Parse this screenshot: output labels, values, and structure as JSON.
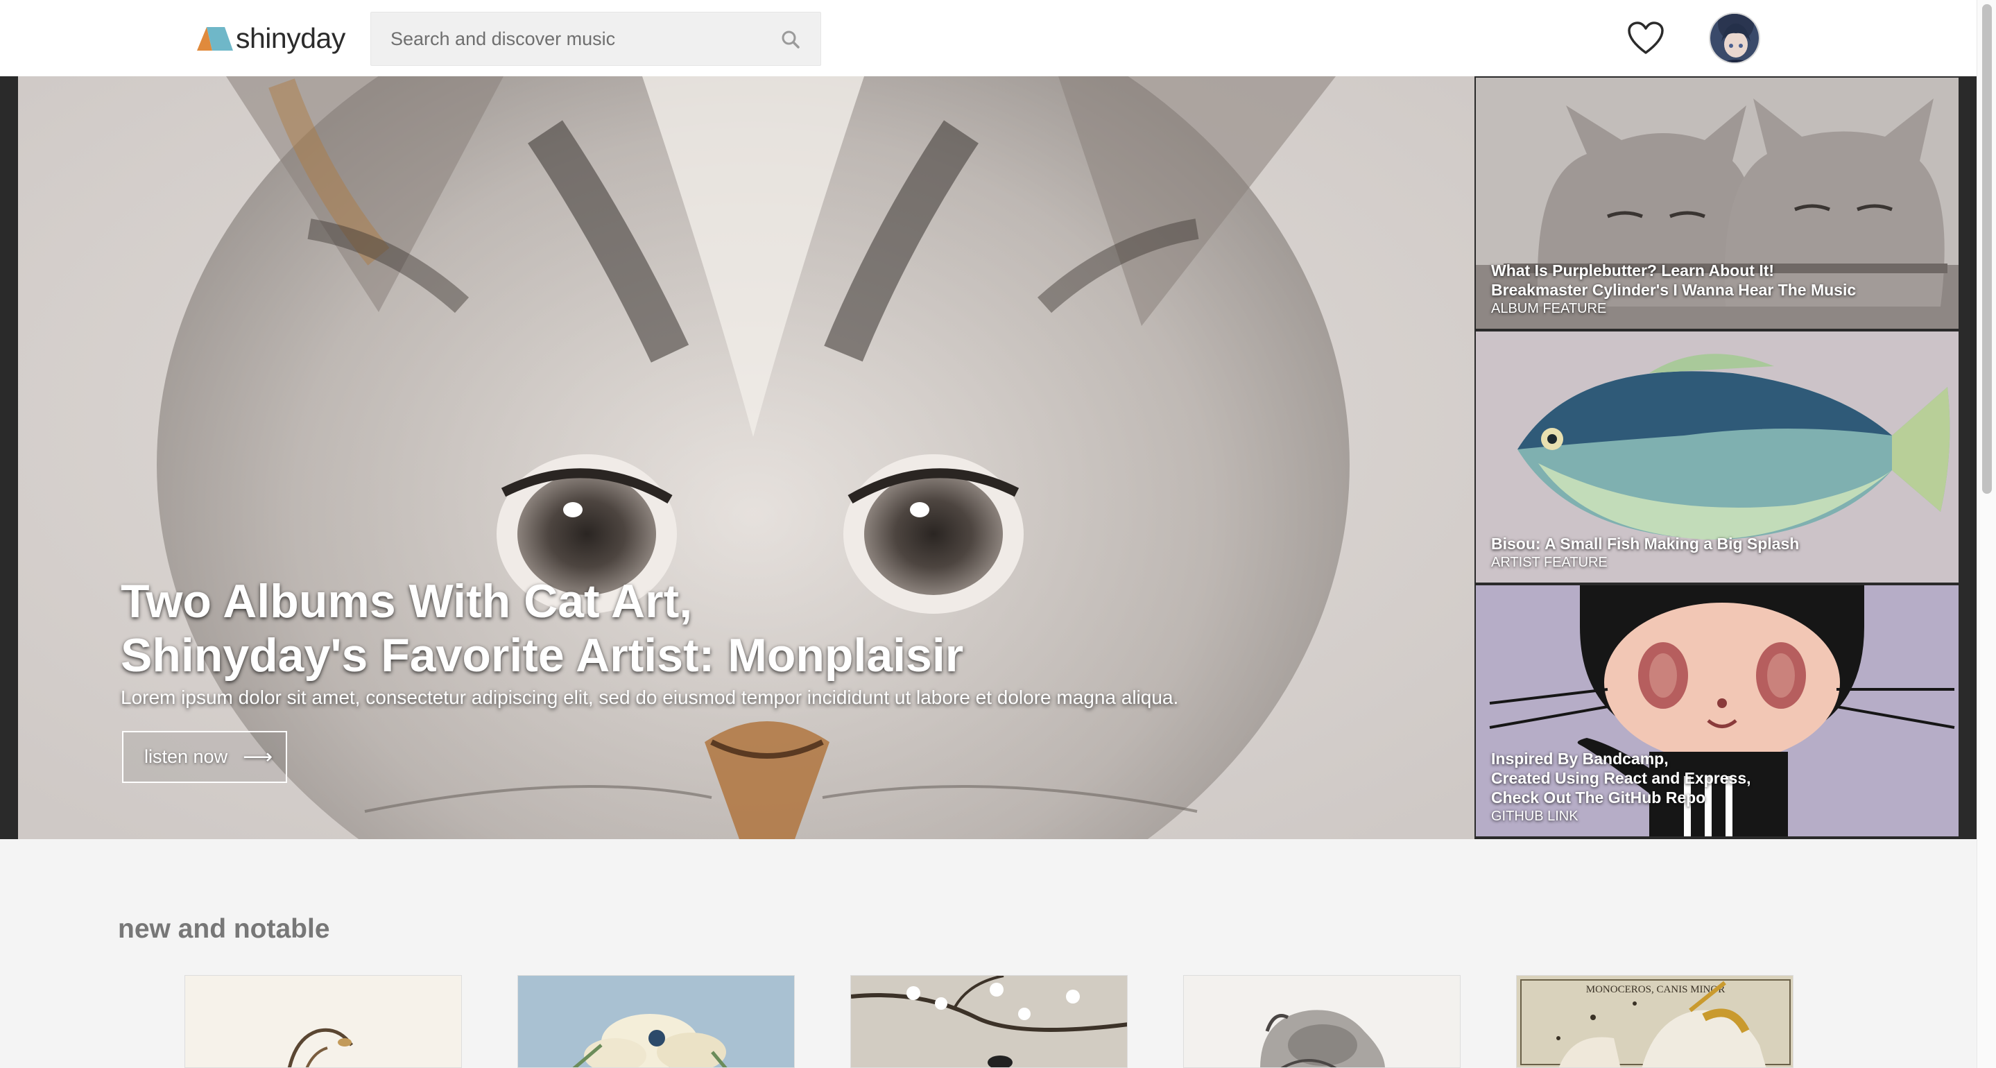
{
  "header": {
    "logo_text": "shinyday",
    "search_placeholder": "Search and discover music"
  },
  "hero": {
    "title_line1": "Two Albums With Cat Art,",
    "title_line2": "Shinyday's Favorite Artist: Monplaisir",
    "subtitle": "Lorem ipsum dolor sit amet, consectetur adipiscing elit, sed do eiusmod tempor incididunt ut labore et dolore magna aliqua.",
    "cta_label": "listen now",
    "cta_arrow": "⟶"
  },
  "features": [
    {
      "title_lines": [
        "What Is Purplebutter? Learn About It!",
        "Breakmaster Cylinder's I Wanna Hear The Music"
      ],
      "type": "ALBUM FEATURE"
    },
    {
      "title_lines": [
        "Bisou: A Small Fish Making a Big Splash"
      ],
      "type": "ARTIST FEATURE"
    },
    {
      "title_lines": [
        "Inspired By Bandcamp,",
        "Created Using React and Express,",
        "Check Out The GitHub Repo"
      ],
      "type": "GITHUB LINK"
    }
  ],
  "new_and_notable": {
    "heading": "new and notable",
    "albums": [
      {
        "art": "bird-on-branch"
      },
      {
        "art": "white-flowers"
      },
      {
        "art": "cherry-blossom"
      },
      {
        "art": "rodent-sketch"
      },
      {
        "art": "constellation-map",
        "caption": "MONOCEROS, CANIS MINOR"
      }
    ]
  },
  "colors": {
    "header_bg": "#ffffff",
    "page_bg": "#f4f4f4",
    "hero_frame": "#2a2a2a",
    "heading_gray": "#777777",
    "logo_orange": "#e08a3c",
    "logo_blue": "#6fb7c8"
  }
}
